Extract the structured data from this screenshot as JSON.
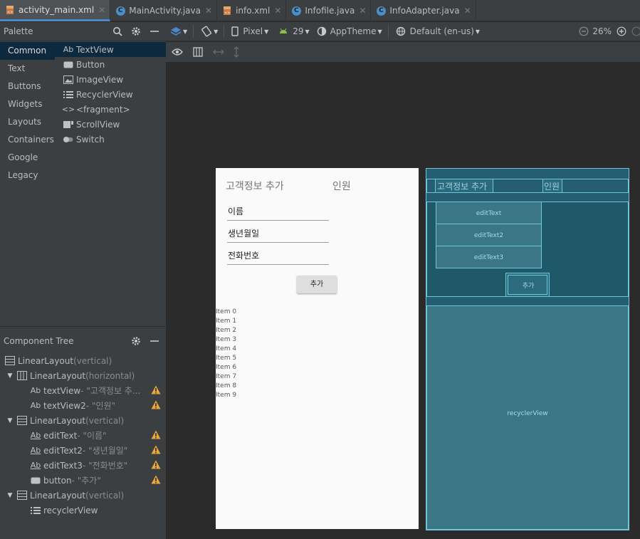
{
  "tabs": [
    {
      "label": "activity_main.xml",
      "icon": "xml-layout-icon",
      "active": true
    },
    {
      "label": "MainActivity.java",
      "icon": "class-icon",
      "active": false
    },
    {
      "label": "info.xml",
      "icon": "xml-layout-icon",
      "active": false
    },
    {
      "label": "Infofile.java",
      "icon": "class-icon",
      "active": false
    },
    {
      "label": "InfoAdapter.java",
      "icon": "class-icon",
      "active": false
    }
  ],
  "palette": {
    "title": "Palette",
    "categories": [
      "Common",
      "Text",
      "Buttons",
      "Widgets",
      "Layouts",
      "Containers",
      "Google",
      "Legacy"
    ],
    "selected_category": "Common",
    "widgets": [
      {
        "label": "TextView",
        "icon_text": "Ab"
      },
      {
        "label": "Button",
        "icon_text": ""
      },
      {
        "label": "ImageView",
        "icon_text": ""
      },
      {
        "label": "RecyclerView",
        "icon_text": ""
      },
      {
        "label": "<fragment>",
        "icon_text": "<>"
      },
      {
        "label": "ScrollView",
        "icon_text": ""
      },
      {
        "label": "Switch",
        "icon_text": ""
      }
    ]
  },
  "toolbar": {
    "device": "Pixel",
    "api": "29",
    "theme": "AppTheme",
    "locale": "Default (en-us)",
    "zoom": "26%"
  },
  "component_tree": {
    "title": "Component Tree",
    "nodes": [
      {
        "name": "LinearLayout",
        "detail": "(vertical)"
      },
      {
        "name": "LinearLayout",
        "detail": "(horizontal)"
      },
      {
        "name": "textView",
        "detail": "- \"고객정보 추...",
        "warn": true
      },
      {
        "name": "textView2",
        "detail": "- \"인원\"",
        "warn": true
      },
      {
        "name": "LinearLayout",
        "detail": "(vertical)"
      },
      {
        "name": "editText",
        "detail": "- \"이름\"",
        "warn": true
      },
      {
        "name": "editText2",
        "detail": "- \"생년월일\"",
        "warn": true
      },
      {
        "name": "editText3",
        "detail": "- \"전화번호\"",
        "warn": true
      },
      {
        "name": "button",
        "detail": "- \"추가\"",
        "warn": true
      },
      {
        "name": "LinearLayout",
        "detail": "(vertical)"
      },
      {
        "name": "recyclerView",
        "detail": ""
      }
    ]
  },
  "design": {
    "title1": "고객정보 추가",
    "title2": "인원",
    "input1": "이름",
    "input2": "생년월일",
    "input3": "전화번호",
    "button": "추가",
    "items": [
      "Item 0",
      "Item 1",
      "Item 2",
      "Item 3",
      "Item 4",
      "Item 5",
      "Item 6",
      "Item 7",
      "Item 8",
      "Item 9"
    ]
  },
  "blueprint": {
    "title1": "고객정보 추가",
    "title2": "인원",
    "edit1": "editText",
    "edit2": "editText2",
    "edit3": "editText3",
    "button": "추가",
    "recycler": "recyclerView"
  },
  "colors": {
    "accent": "#4a88c7",
    "warning": "#e8a93a",
    "blueprint_bg": "#265e71"
  }
}
